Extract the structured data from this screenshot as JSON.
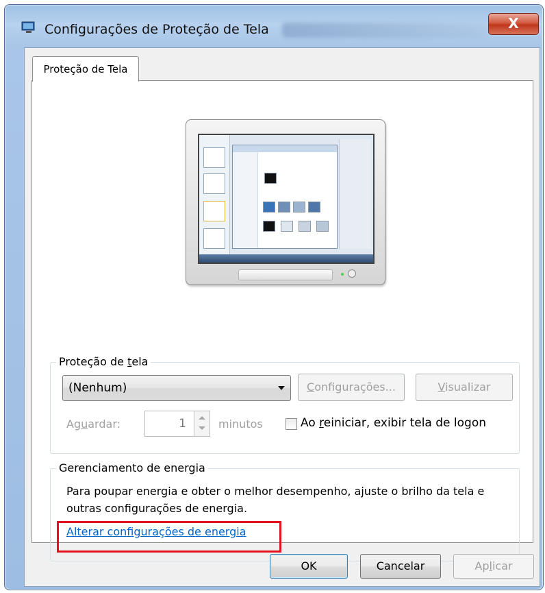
{
  "window": {
    "title": "Configurações de Proteção de Tela",
    "close_label": "X"
  },
  "tabs": [
    {
      "label": "Proteção de Tela",
      "active": true
    }
  ],
  "screensaver": {
    "group_label_pre": "Proteção de ",
    "group_label_ul": "t",
    "group_label_post": "ela",
    "selected_value": "(Nenhum)",
    "settings_button_pre": "",
    "settings_button_ul": "C",
    "settings_button_post": "onfigurações...",
    "preview_button_pre": "",
    "preview_button_ul": "V",
    "preview_button_post": "isualizar",
    "wait_label_pre": "Ag",
    "wait_label_ul": "u",
    "wait_label_post": "ardar:",
    "wait_value": "1",
    "minutes_label": "minutos",
    "checkbox_label_pre": "Ao ",
    "checkbox_label_ul": "r",
    "checkbox_label_post": "einiciar, exibir tela de logon",
    "checkbox_checked": false
  },
  "power": {
    "group_label": "Gerenciamento de energia",
    "description": "Para poupar energia e obter o melhor desempenho, ajuste o brilho da tela e outras configurações de energia.",
    "link_label": "Alterar configurações de energia"
  },
  "footer": {
    "ok_label": "OK",
    "cancel_label": "Cancelar",
    "apply_label_pre": "Ap",
    "apply_label_ul": "l",
    "apply_label_post": "icar"
  },
  "colors": {
    "link": "#0066cc",
    "highlight": "#e0141e",
    "close_button": "#c0361b"
  }
}
